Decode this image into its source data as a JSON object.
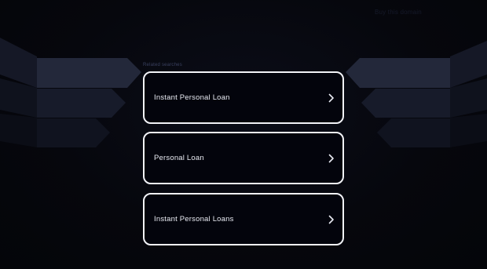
{
  "header": {
    "top_link": "Buy this domain"
  },
  "related": {
    "heading": "Related searches",
    "items": [
      {
        "label": "Instant Personal Loan",
        "icon": "chevron-right-icon"
      },
      {
        "label": "Personal Loan",
        "icon": "chevron-right-icon"
      },
      {
        "label": "Instant Personal Loans",
        "icon": "chevron-right-icon"
      }
    ]
  },
  "colors": {
    "background": "#05060c",
    "card_border": "#f2f3f7",
    "card_fill": "#03040c",
    "text": "#e8eaf2"
  }
}
